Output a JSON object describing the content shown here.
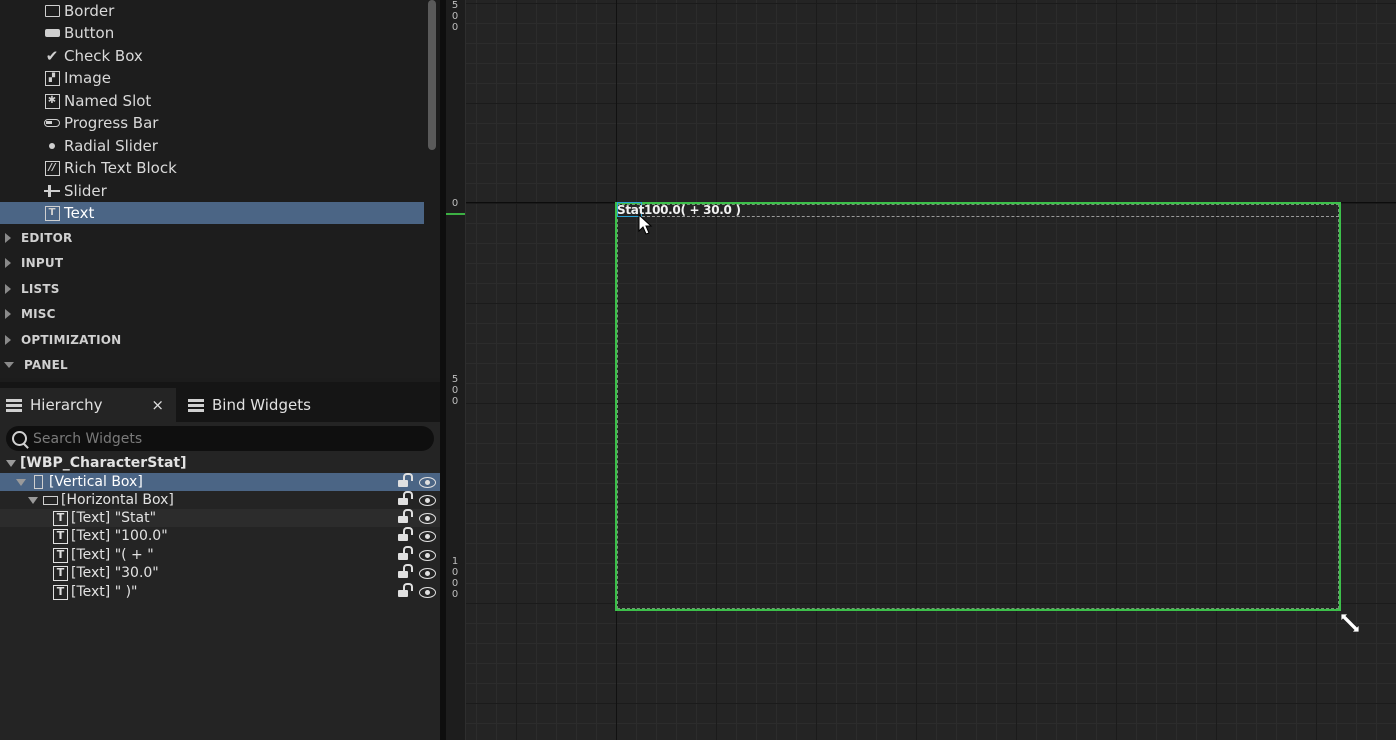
{
  "palette": {
    "items": [
      {
        "label": "Border",
        "icon": "border-icon"
      },
      {
        "label": "Button",
        "icon": "button-icon"
      },
      {
        "label": "Check Box",
        "icon": "checkbox-icon"
      },
      {
        "label": "Image",
        "icon": "image-icon"
      },
      {
        "label": "Named Slot",
        "icon": "named-slot-icon"
      },
      {
        "label": "Progress Bar",
        "icon": "progress-bar-icon"
      },
      {
        "label": "Radial Slider",
        "icon": "radial-slider-icon"
      },
      {
        "label": "Rich Text Block",
        "icon": "rich-text-icon"
      },
      {
        "label": "Slider",
        "icon": "slider-icon"
      },
      {
        "label": "Text",
        "icon": "text-icon",
        "selected": true
      }
    ],
    "categories": [
      {
        "label": "EDITOR",
        "expanded": false
      },
      {
        "label": "INPUT",
        "expanded": false
      },
      {
        "label": "LISTS",
        "expanded": false
      },
      {
        "label": "MISC",
        "expanded": false
      },
      {
        "label": "OPTIMIZATION",
        "expanded": false
      },
      {
        "label": "PANEL",
        "expanded": true
      }
    ]
  },
  "tabs": {
    "hierarchy": "Hierarchy",
    "bind_widgets": "Bind Widgets",
    "close": "×"
  },
  "search": {
    "placeholder": "Search Widgets",
    "value": ""
  },
  "hierarchy": {
    "rows": [
      {
        "label": "[WBP_CharacterStat]",
        "type": "root"
      },
      {
        "label": "[Vertical Box]",
        "type": "vertical-box",
        "selected": true
      },
      {
        "label": "[Horizontal Box]",
        "type": "horizontal-box"
      },
      {
        "label": "[Text] \"Stat\"",
        "type": "text"
      },
      {
        "label": "[Text] \"100.0\"",
        "type": "text"
      },
      {
        "label": "[Text] \"( + \"",
        "type": "text"
      },
      {
        "label": "[Text] \"30.0\"",
        "type": "text"
      },
      {
        "label": "[Text] \" )\"",
        "type": "text"
      }
    ]
  },
  "ruler": {
    "labels": [
      {
        "digits": [
          "5",
          "0",
          "0"
        ]
      },
      {
        "digits": [
          "0"
        ]
      },
      {
        "digits": [
          "5",
          "0",
          "0"
        ]
      },
      {
        "digits": [
          "1",
          "0",
          "0",
          "0"
        ]
      }
    ]
  },
  "canvas": {
    "preview_text": "Stat100.0( + 30.0 )",
    "frame_color": "#3cc04a",
    "selection_color": "#29a3d6"
  },
  "colors": {
    "selection": "#4b6585",
    "accent_green": "#3cb043"
  }
}
